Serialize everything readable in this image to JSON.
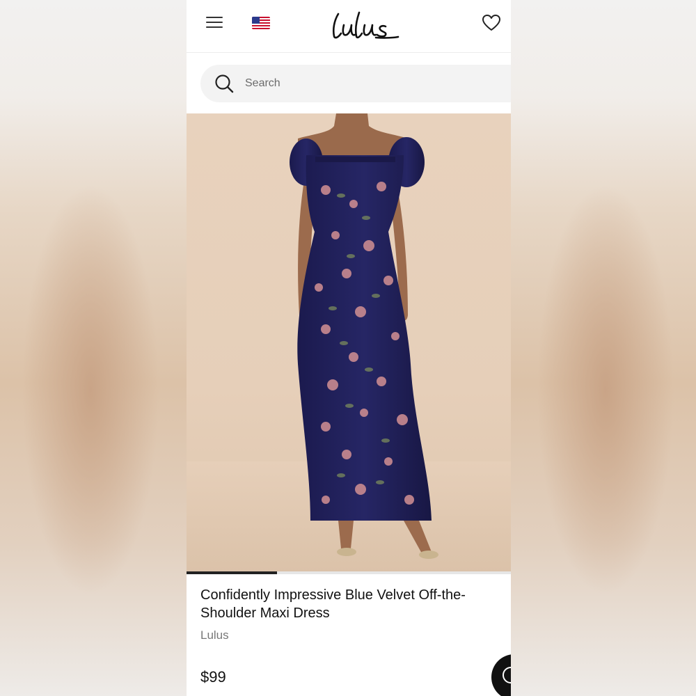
{
  "header": {
    "brand_logo_text": "Lulus",
    "menu_icon": "hamburger-menu-icon",
    "flag_icon": "us-flag-icon",
    "wishlist_icon": "heart-icon"
  },
  "search": {
    "placeholder": "Search",
    "icon": "search-icon"
  },
  "product": {
    "image_description_icon": "dress-photo",
    "gallery_progress": 0.28,
    "title": "Confidently Impressive Blue Velvet Off-the-Shoulder Maxi Dress",
    "brand": "Lulus",
    "price": "$99"
  },
  "chat": {
    "icon": "chat-icon"
  },
  "colors": {
    "accent": "#111111",
    "search_bg": "#f3f3f3",
    "dress_navy": "#1f1f5a",
    "floral_pink": "#c98a90"
  }
}
